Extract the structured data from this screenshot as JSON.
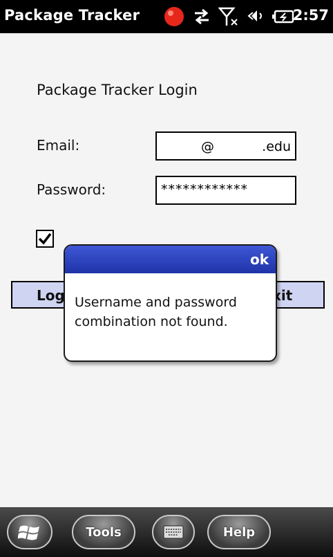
{
  "titlebar": {
    "app_title": "Package Tracker",
    "clock": "2:57",
    "icons": [
      "recording-indicator-icon",
      "data-sync-icon",
      "no-signal-icon",
      "volume-icon",
      "battery-charging-icon"
    ]
  },
  "form": {
    "heading": "Package Tracker Login",
    "email_label": "Email:",
    "email_value": {
      "at": "@",
      "domain": ".edu"
    },
    "password_label": "Password:",
    "password_value": "************",
    "remember_checked": true
  },
  "buttons": {
    "login_visible": "Log",
    "exit_visible": "xit"
  },
  "dialog": {
    "ok_label": "ok",
    "message": "Username and password combination not found."
  },
  "bottombar": {
    "tools_label": "Tools",
    "help_label": "Help"
  },
  "colors": {
    "dialog_header": "#2a40bd",
    "button_fill": "#cfd4f2",
    "background": "#f4f4f4"
  }
}
